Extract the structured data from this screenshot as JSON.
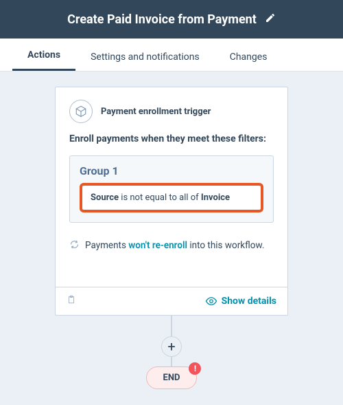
{
  "header": {
    "title": "Create Paid Invoice from Payment"
  },
  "tabs": {
    "actions": "Actions",
    "settings": "Settings and notifications",
    "changes": "Changes"
  },
  "trigger": {
    "label": "Payment enrollment trigger",
    "description": "Enroll payments when they meet these filters:",
    "group": {
      "title": "Group 1",
      "filter": {
        "field": "Source",
        "operator": " is not equal to all of ",
        "value": "Invoice"
      }
    },
    "reenroll": {
      "prefix": "Payments ",
      "link": "won't re-enroll",
      "suffix": " into this workflow."
    }
  },
  "footer": {
    "show_details": "Show details"
  },
  "flow": {
    "add": "+",
    "end": "END",
    "alert": "!"
  }
}
